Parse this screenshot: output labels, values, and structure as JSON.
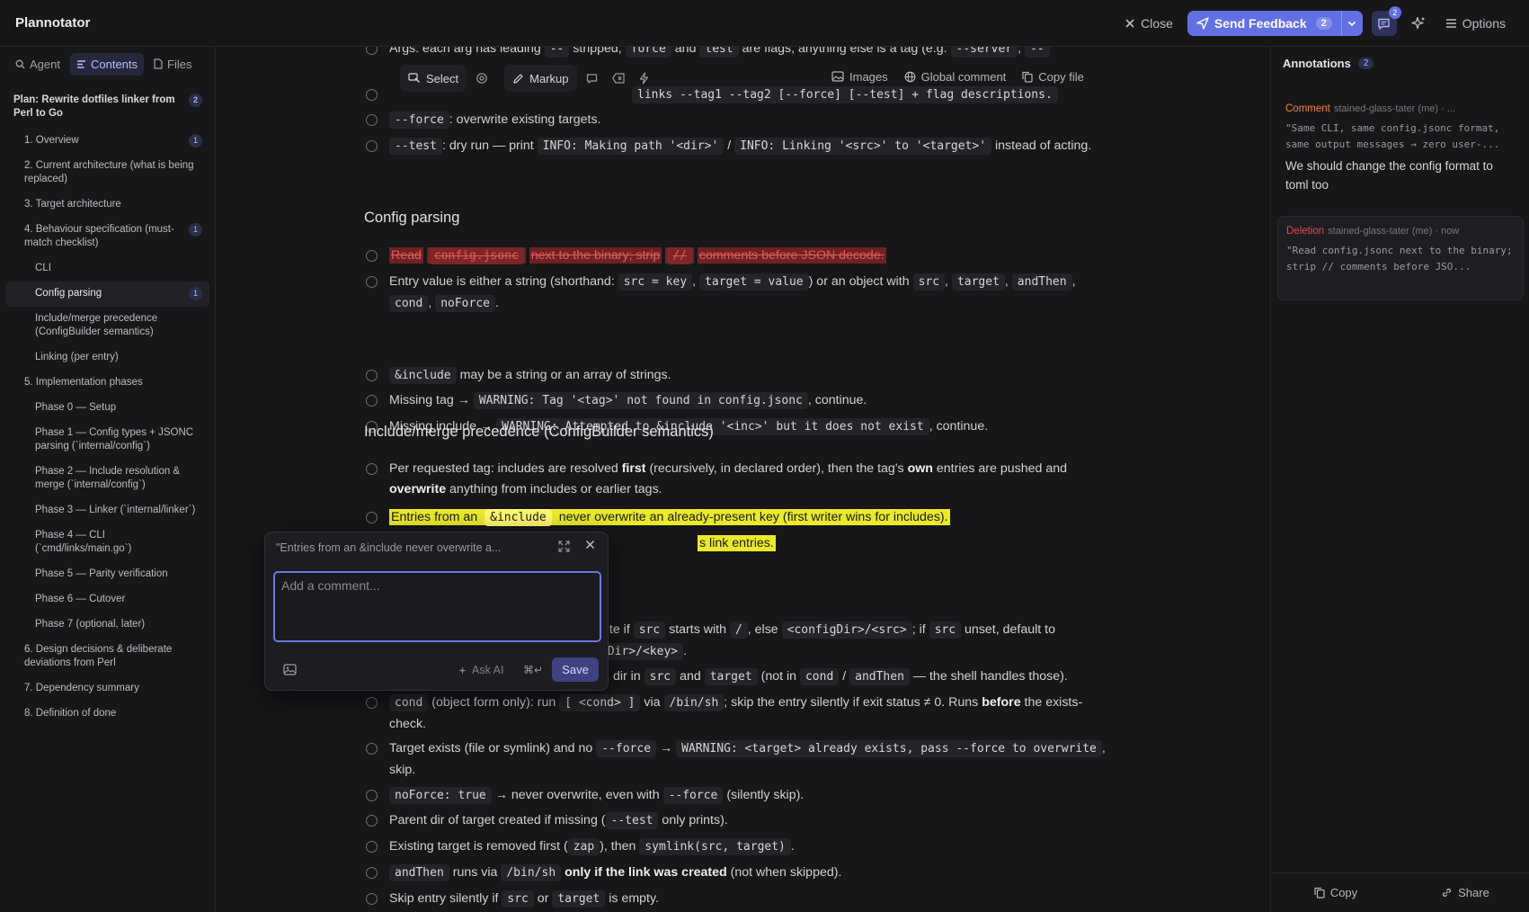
{
  "app": {
    "title": "Plannotator"
  },
  "header": {
    "close_label": "Close",
    "send_label": "Send Feedback",
    "send_count": "2",
    "annotations_badge": "2",
    "options_label": "Options"
  },
  "sidebar": {
    "tabs": [
      {
        "label": "Agent"
      },
      {
        "label": "Contents"
      },
      {
        "label": "Files"
      }
    ],
    "toc": [
      {
        "label": "Plan: Rewrite dotfiles linker from Perl to Go",
        "badge": "2"
      },
      {
        "label": "1. Overview",
        "badge": "1"
      },
      {
        "label": "2. Current architecture (what is being replaced)",
        "badge": ""
      },
      {
        "label": "3. Target architecture",
        "badge": ""
      },
      {
        "label": "4. Behaviour specification (must-match checklist)",
        "badge": "1"
      },
      {
        "label": "CLI",
        "badge": ""
      },
      {
        "label": "Config parsing",
        "badge": "1"
      },
      {
        "label": "Include/merge precedence (ConfigBuilder semantics)",
        "badge": ""
      },
      {
        "label": "Linking (per entry)",
        "badge": ""
      },
      {
        "label": "5. Implementation phases",
        "badge": ""
      },
      {
        "label": "Phase 0 — Setup",
        "badge": ""
      },
      {
        "label": "Phase 1 — Config types + JSONC parsing (`internal/config`)",
        "badge": ""
      },
      {
        "label": "Phase 2 — Include resolution & merge (`internal/config`)",
        "badge": ""
      },
      {
        "label": "Phase 3 — Linker (`internal/linker`)",
        "badge": ""
      },
      {
        "label": "Phase 4 — CLI (`cmd/links/main.go`)",
        "badge": ""
      },
      {
        "label": "Phase 5 — Parity verification",
        "badge": ""
      },
      {
        "label": "Phase 6 — Cutover",
        "badge": ""
      },
      {
        "label": "Phase 7 (optional, later)",
        "badge": ""
      },
      {
        "label": "6. Design decisions & deliberate deviations from Perl",
        "badge": ""
      },
      {
        "label": "7. Dependency summary",
        "badge": ""
      },
      {
        "label": "8. Definition of done",
        "badge": ""
      }
    ]
  },
  "toolbar": {
    "select_label": "Select",
    "markup_label": "Markup",
    "images_label": "Images",
    "global_comment_label": "Global comment",
    "copy_file_label": "Copy file"
  },
  "doc": {
    "cli_a1": "Args: each arg has leading ",
    "cli_a2": "--",
    "cli_a3": " stripped; ",
    "cli_a4": "force",
    "cli_a5": " and ",
    "cli_a6": "test",
    "cli_a7": " are flags, anything else is a tag (e.g. ",
    "cli_a8": "--server",
    "cli_a9": ", ",
    "cli_a10": "--",
    "cli_b": "links --tag1 --tag2 [--force] [--test] + flag descriptions.",
    "cli_c1": "--force",
    "cli_c2": ": overwrite existing targets.",
    "cli_d1": "--test",
    "cli_d2": ": dry run — print ",
    "cli_d3": "INFO: Making path '<dir>'",
    "cli_d4": " / ",
    "cli_d5": "INFO: Linking '<src>' to '<target>'",
    "cli_d6": " instead of acting.",
    "h_config": "Config parsing",
    "cfg_del1": "Read",
    "cfg_del2": "config.jsonc",
    "cfg_del3": "next to the binary; strip",
    "cfg_del4": "//",
    "cfg_del5": "comments before JSON decode.",
    "cfg_b1": "Entry value is either a string (shorthand: ",
    "cfg_b2": "src = key",
    "cfg_b3": ", ",
    "cfg_b4": "target = value",
    "cfg_b5": ") or an object with ",
    "cfg_b6": "src",
    "cfg_b7": ", ",
    "cfg_b8": "target",
    "cfg_b9": ", ",
    "cfg_b10": "andThen",
    "cfg_b11": ", ",
    "cfg_b12": "cond",
    "cfg_b13": ", ",
    "cfg_b14": "noForce",
    "cfg_b15": ".",
    "cfg_c1": "&include",
    "cfg_c2": " may be a string or an array of strings.",
    "cfg_d1": "Missing tag → ",
    "cfg_d2": "WARNING: Tag '<tag>' not found in config.jsonc",
    "cfg_d3": ", continue.",
    "cfg_e1": "Missing include → ",
    "cfg_e2": "WARNING: Attempted to &include '<inc>' but it does not exist",
    "cfg_e3": ", continue.",
    "h_include": "Include/merge precedence (ConfigBuilder semantics)",
    "inc_a1": "Per requested tag: includes are resolved ",
    "inc_a2": "first",
    "inc_a3": " (recursively, in declared order), then the tag's ",
    "inc_a4": "own",
    "inc_a5": " entries are pushed and ",
    "inc_a6": "overwrite",
    "inc_a7": " anything from includes or earlier tags.",
    "inc_b1": "Entries from an ",
    "inc_b2": "&include",
    "inc_b3": " never overwrite an already-present key (first writer wins for includes).",
    "inc_c": "s link entries.",
    "lnk_a1": "ute if ",
    "lnk_a2": "src",
    "lnk_a3": " starts with ",
    "lnk_a4": "/",
    "lnk_a5": ", else ",
    "lnk_a6": "<configDir>/<src>",
    "lnk_a7": "; if ",
    "lnk_a8": "src",
    "lnk_a9": " unset, default to",
    "lnk_a10": "gDir>/<key>",
    "lnk_a11": ".",
    "lnk_b1": " dir in ",
    "lnk_b2": "src",
    "lnk_b3": " and ",
    "lnk_b4": "target",
    "lnk_b5": " (not in ",
    "lnk_b6": "cond",
    "lnk_b7": " / ",
    "lnk_b8": "andThen",
    "lnk_b9": " — the shell handles those).",
    "lnk_c1": "cond",
    "lnk_c2": " (object form only): run ",
    "lnk_c3": "[ <cond> ]",
    "lnk_c4": " via ",
    "lnk_c5": "/bin/sh",
    "lnk_c6": "; skip the entry silently if exit status ≠ 0. Runs ",
    "lnk_c7": "before",
    "lnk_c8": " the exists-check.",
    "lnk_d1": "Target exists (file or symlink) and no ",
    "lnk_d2": "--force",
    "lnk_d3": " → ",
    "lnk_d4": "WARNING: <target> already exists, pass --force to overwrite",
    "lnk_d5": ", skip.",
    "lnk_e1": "noForce: true",
    "lnk_e2": " → never overwrite, even with ",
    "lnk_e3": "--force",
    "lnk_e4": " (silently skip).",
    "lnk_f1": "Parent dir of target created if missing (",
    "lnk_f2": "--test",
    "lnk_f3": " only prints).",
    "lnk_g1": "Existing target is removed first (",
    "lnk_g2": "zap",
    "lnk_g3": "), then ",
    "lnk_g4": "symlink(src, target)",
    "lnk_g5": ".",
    "lnk_h1": "andThen",
    "lnk_h2": " runs via ",
    "lnk_h3": "/bin/sh",
    "lnk_h4": " only if the link was created",
    "lnk_h5": " (not when skipped).",
    "lnk_i1": "Skip entry silently if ",
    "lnk_i2": "src",
    "lnk_i3": " or ",
    "lnk_i4": "target",
    "lnk_i5": " is empty."
  },
  "popup": {
    "title": "\"Entries from an &include never overwrite a...",
    "placeholder": "Add a comment...",
    "ask_ai_label": "Ask AI",
    "shortcut": "⌘↵",
    "save_label": "Save"
  },
  "annotations": {
    "title": "Annotations",
    "count": "2",
    "items": [
      {
        "type": "Comment",
        "meta": "stained-glass-tater (me) · ...",
        "quote": "\"Same CLI, same config.jsonc format, same output messages → zero user-...",
        "text": "We should change the config format to toml too"
      },
      {
        "type": "Deletion",
        "meta": "stained-glass-tater (me) · now",
        "quote": "\"Read config.jsonc next to the binary; strip // comments before JSO..."
      }
    ],
    "copy_label": "Copy",
    "share_label": "Share"
  },
  "colors": {
    "accent": "#6270e4",
    "comment": "#f0833a",
    "deletion": "#e5484d",
    "highlight": "#eaea2c"
  }
}
